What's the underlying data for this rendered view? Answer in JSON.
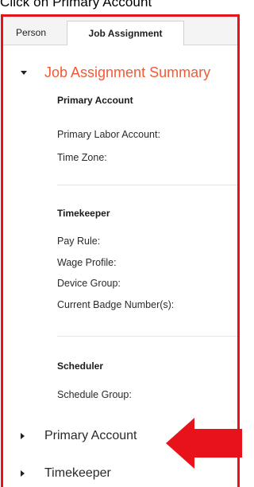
{
  "instruction": "Click on Primary Account",
  "tabs": [
    {
      "label": "Person"
    },
    {
      "label": "Job Assignment"
    }
  ],
  "summary": {
    "title": "Job Assignment Summary"
  },
  "sections": {
    "primary_account": {
      "heading": "Primary Account",
      "fields": [
        "Primary Labor Account:",
        "Time Zone:"
      ]
    },
    "timekeeper": {
      "heading": "Timekeeper",
      "fields": [
        "Pay Rule:",
        "Wage Profile:",
        "Device Group:",
        "Current Badge Number(s):"
      ]
    },
    "scheduler": {
      "heading": "Scheduler",
      "fields": [
        "Schedule Group:"
      ]
    }
  },
  "collapsed": [
    {
      "label": "Primary Account"
    },
    {
      "label": "Timekeeper"
    }
  ],
  "colors": {
    "highlight_border": "#e8131a",
    "summary_title": "#f05a34",
    "arrow": "#e8131a"
  },
  "icons": [
    "caret-down-icon",
    "caret-right-icon",
    "red-arrow-icon"
  ]
}
